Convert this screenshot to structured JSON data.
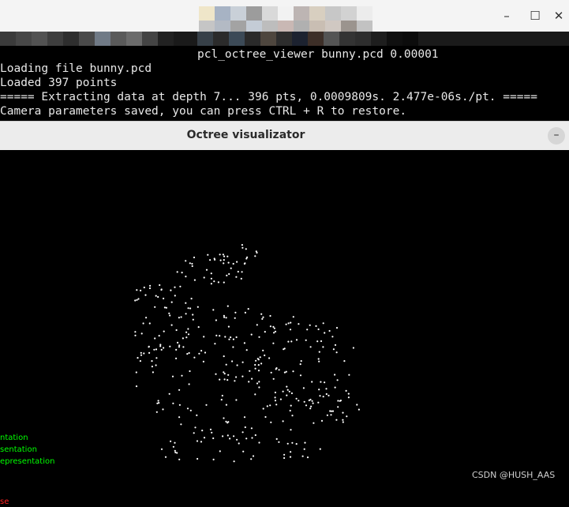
{
  "terminal": {
    "command": "pcl_octree_viewer bunny.pcd 0.00001",
    "lines": [
      "Loading file bunny.pcd",
      "Loaded 397 points",
      "===== Extracting data at depth 7... 396 pts, 0.0009809s. 2.477e-06s./pt. =====",
      "Camera parameters saved, you can press CTRL + R to restore."
    ],
    "controls": {
      "minimize": "–",
      "maximize": "☐",
      "close": "✕"
    }
  },
  "viewer": {
    "title": "Octree visualizator",
    "minimize": "–",
    "legend": [
      "ntation",
      "sentation",
      "epresentation"
    ],
    "legend_red": "se",
    "point_color": "#ffffff",
    "legend_color": "#00ff00"
  },
  "watermark": "CSDN @HUSH_AAS"
}
